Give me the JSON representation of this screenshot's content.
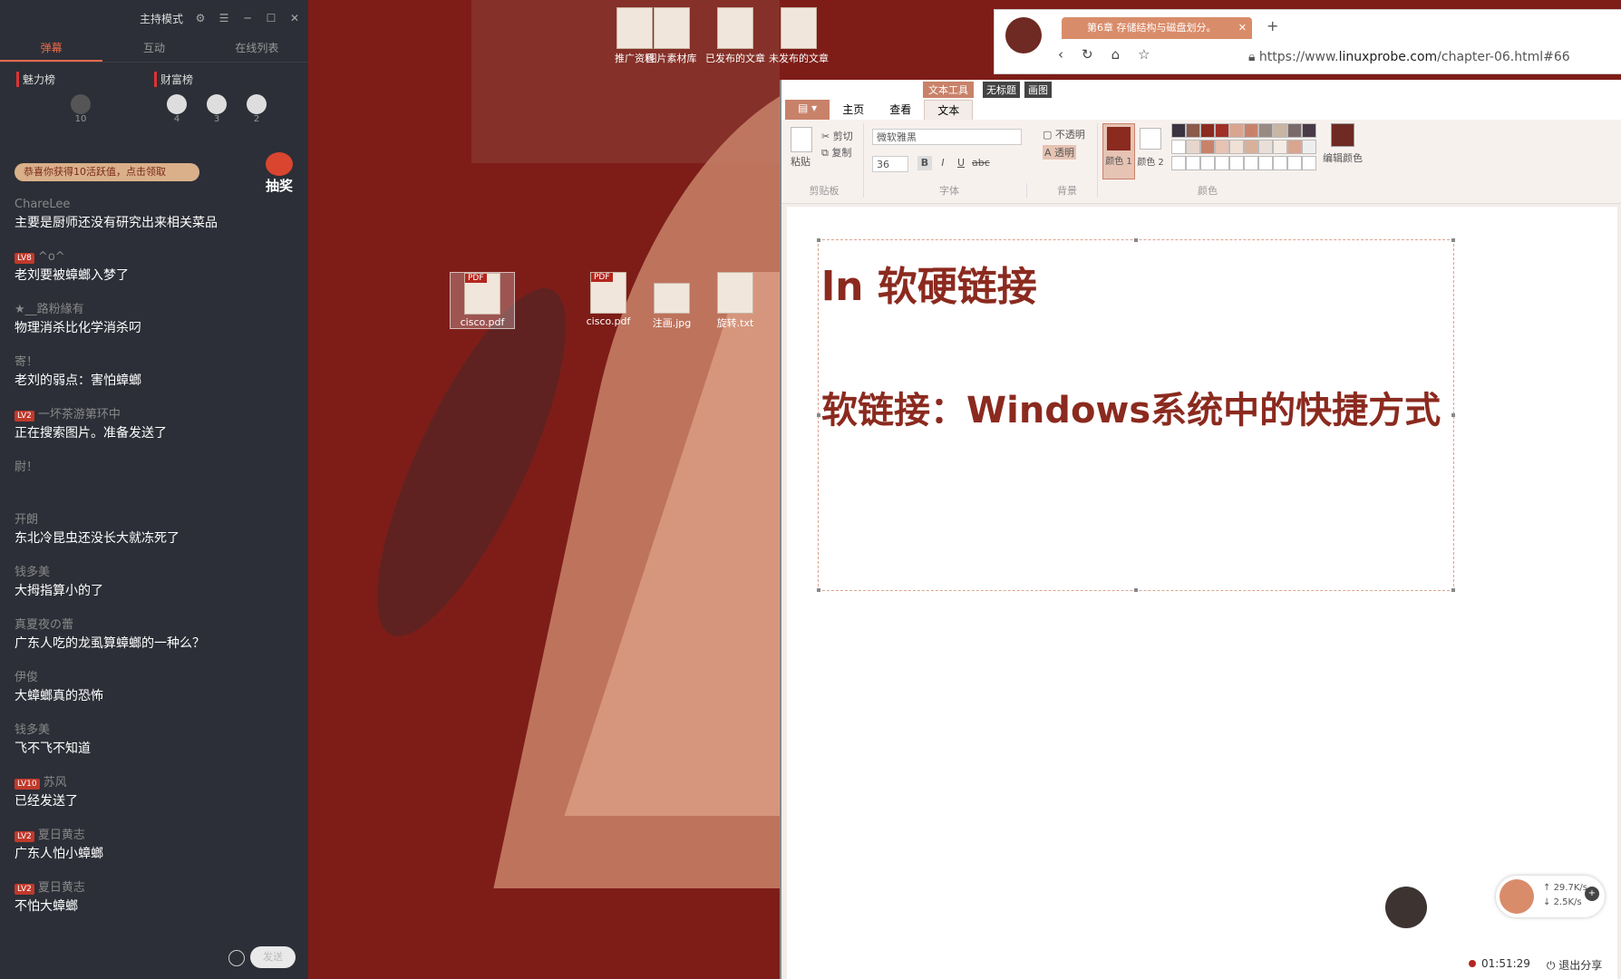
{
  "streamer_panel": {
    "mode_title": "主持模式",
    "tabs": [
      "弹幕",
      "互动",
      "在线列表"
    ],
    "charm_board": {
      "label": "魅力榜",
      "count": "10"
    },
    "wealth_board": {
      "label": "财富榜",
      "counts": [
        "4",
        "3",
        "2"
      ]
    },
    "promo_text": "恭喜你获得10活跃值，点击领取",
    "lottery_label": "抽奖",
    "messages": [
      {
        "level": "",
        "user": "ChareLee",
        "text": "主要是厨师还没有研究出来相关菜品"
      },
      {
        "level": "LV8",
        "user": "^o^",
        "text": "老刘要被蟑螂入梦了"
      },
      {
        "level": "",
        "user": "★__路粉緣有",
        "text": "物理消杀比化学消杀叼"
      },
      {
        "level": "",
        "user": "寄！",
        "text": "老刘的弱点：害怕蟑螂"
      },
      {
        "level": "LV2",
        "user": "一坏茶游第环中",
        "text": "正在搜索图片。准备发送了"
      },
      {
        "level": "",
        "user": "尉！",
        "text": ""
      },
      {
        "level": "",
        "user": "开朗",
        "text": "东北冷昆虫还没长大就冻死了"
      },
      {
        "level": "",
        "user": "钱多美",
        "text": "大拇指算小的了"
      },
      {
        "level": "",
        "user": "真夏夜の蕾",
        "text": "广东人吃的龙虱算蟑螂的一种么？"
      },
      {
        "level": "",
        "user": "伊俊",
        "text": "大蟑螂真的恐怖"
      },
      {
        "level": "",
        "user": "钱多美",
        "text": "飞不飞不知道"
      },
      {
        "level": "LV10",
        "user": "苏风",
        "text": "已经发送了"
      },
      {
        "level": "LV2",
        "user": "夏日黄志",
        "text": "广东人怕小蟑螂"
      },
      {
        "level": "LV2",
        "user": "夏日黄志",
        "text": "不怕大蟑螂"
      }
    ],
    "send_label": "发送"
  },
  "desktop_icons": {
    "top": [
      "推广资料",
      "图片素材库",
      "已发布的文章",
      "未发布的文章"
    ],
    "middle": [
      "cisco.pdf",
      "cisco.pdf",
      "注画.jpg",
      "旋转.txt"
    ]
  },
  "browser": {
    "tab_title": "第6章 存储结构与磁盘划分。",
    "url_prefix": "https://www.",
    "url_domain": "linuxprobe.com",
    "url_suffix": "/chapter-06.html#66"
  },
  "paint": {
    "title_tool": "文本工具",
    "title_doc": "无标题",
    "title_app": "画图",
    "tabs": [
      "主页",
      "查看",
      "文本"
    ],
    "clipboard": {
      "paste": "粘贴",
      "cut": "剪切",
      "copy": "复制",
      "label": "剪贴板"
    },
    "font": {
      "name": "微软雅黑",
      "size": "36",
      "label": "字体"
    },
    "background": {
      "opaque": "不透明",
      "transparent": "透明",
      "label": "背景"
    },
    "colors": {
      "color1": "颜色 1",
      "color2": "颜色 2",
      "edit": "编辑颜色",
      "label": "颜色"
    },
    "canvas_heading": "ln  软硬链接",
    "canvas_subhead": "软链接：Windows系统中的快捷方式"
  },
  "net_speed": {
    "up": "29.7K/s",
    "down": "2.5K/s"
  },
  "status": {
    "time": "01:51:29",
    "exit_share": "退出分享"
  }
}
